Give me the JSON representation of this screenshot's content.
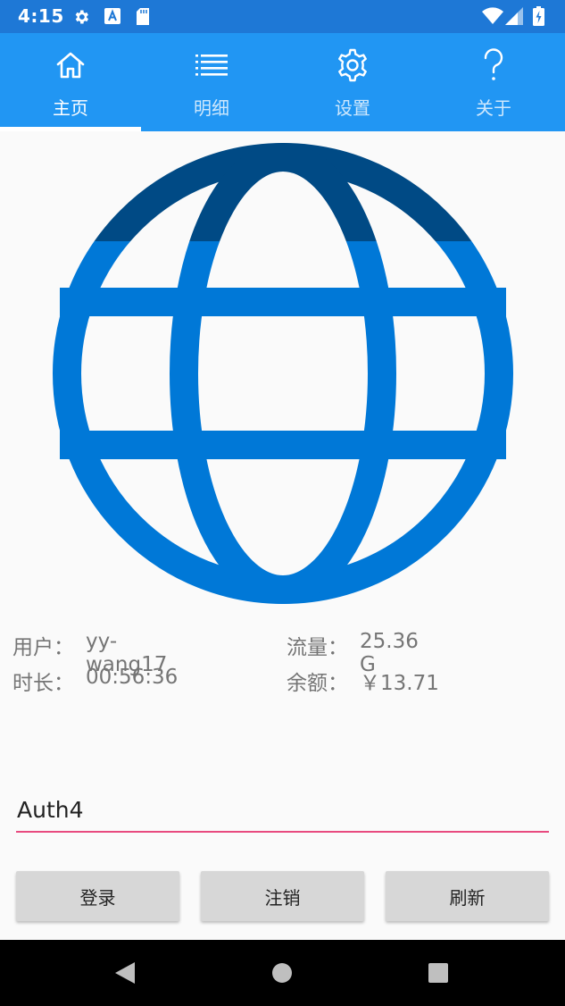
{
  "status_bar": {
    "time": "4:15",
    "icons": [
      "gear-icon",
      "font-icon",
      "sd-card-icon",
      "wifi-icon",
      "signal-icon",
      "battery-icon"
    ]
  },
  "tabs": [
    {
      "label": "主页",
      "icon": "home-icon",
      "selected": true
    },
    {
      "label": "明细",
      "icon": "list-icon",
      "selected": false
    },
    {
      "label": "设置",
      "icon": "gear-icon",
      "selected": false
    },
    {
      "label": "关于",
      "icon": "question-icon",
      "selected": false
    }
  ],
  "globe": {
    "icon": "globe-icon",
    "fill_fraction": 0.78
  },
  "info": {
    "user_label": "用户：",
    "user_value": "yy-wang17",
    "duration_label": "时长：",
    "duration_value": "00:56:36",
    "traffic_label": "流量：",
    "traffic_value": "25.36 G",
    "balance_label": "余额：",
    "balance_value": "￥13.71"
  },
  "auth_input": {
    "value": "Auth4"
  },
  "buttons": {
    "login": "登录",
    "logout": "注销",
    "refresh": "刷新"
  },
  "nav_bar": {
    "icons": [
      "back-icon",
      "home-icon",
      "recents-icon"
    ]
  },
  "colors": {
    "status_bar": "#1e78d6",
    "tab_bar": "#2196f3",
    "globe_fill": "#0078d7",
    "globe_empty": "#004a85",
    "input_underline": "#e84a7f",
    "button_bg": "#d7d7d7"
  }
}
